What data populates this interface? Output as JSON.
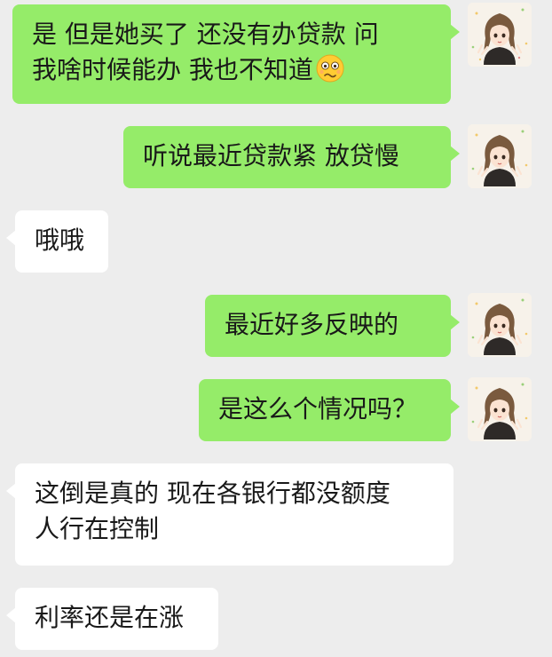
{
  "messages": [
    {
      "sender": "me",
      "line1": "是  但是她买了  还没有办贷款  问",
      "line2": "我啥时候能办  我也不知道",
      "emoji": "worried-face-emoji"
    },
    {
      "sender": "me",
      "text": "听说最近贷款紧  放贷慢"
    },
    {
      "sender": "other",
      "text": "哦哦"
    },
    {
      "sender": "me",
      "text": "最近好多反映的"
    },
    {
      "sender": "me",
      "text": "是这么个情况吗？"
    },
    {
      "sender": "other",
      "line1": "这倒是真的 现在各银行都没额度",
      "line2": "人行在控制"
    },
    {
      "sender": "other",
      "text": "利率还是在涨"
    }
  ],
  "colors": {
    "background": "#ededed",
    "my_bubble": "#95ec69",
    "other_bubble": "#ffffff",
    "text": "#191919"
  },
  "icons": {
    "avatar": "user-avatar-illustrated-girl"
  }
}
